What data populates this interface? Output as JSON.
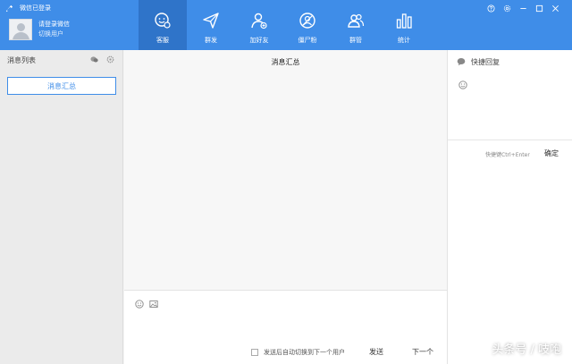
{
  "header": {
    "status_text": "微信已登录",
    "user_name": "请登录微信",
    "user_sub": "切换用户",
    "nav": [
      {
        "label": "客服",
        "icon": "chat-icon",
        "active": true
      },
      {
        "label": "群发",
        "icon": "send-icon",
        "active": false
      },
      {
        "label": "加好友",
        "icon": "add-friend-icon",
        "active": false
      },
      {
        "label": "僵尸粉",
        "icon": "zombie-fans-icon",
        "active": false
      },
      {
        "label": "群管",
        "icon": "group-manage-icon",
        "active": false
      },
      {
        "label": "统计",
        "icon": "stats-icon",
        "active": false
      }
    ],
    "window_controls": [
      "help-icon",
      "settings-icon",
      "minimize-icon",
      "maximize-icon",
      "close-icon"
    ]
  },
  "left": {
    "title": "消息列表",
    "button_label": "消息汇总"
  },
  "center": {
    "title": "消息汇总",
    "auto_switch_label": "发送后自动切换到下一个用户",
    "send_label": "发送",
    "next_label": "下一个"
  },
  "right": {
    "title": "快捷回复",
    "shortcut_hint": "快捷键Ctrl+Enter",
    "confirm_label": "确定"
  },
  "watermark": "头条号 / 吱咆",
  "colors": {
    "header_bg": "#3f8de8",
    "nav_active": "#2f74c9",
    "accent": "#3f8de8"
  }
}
